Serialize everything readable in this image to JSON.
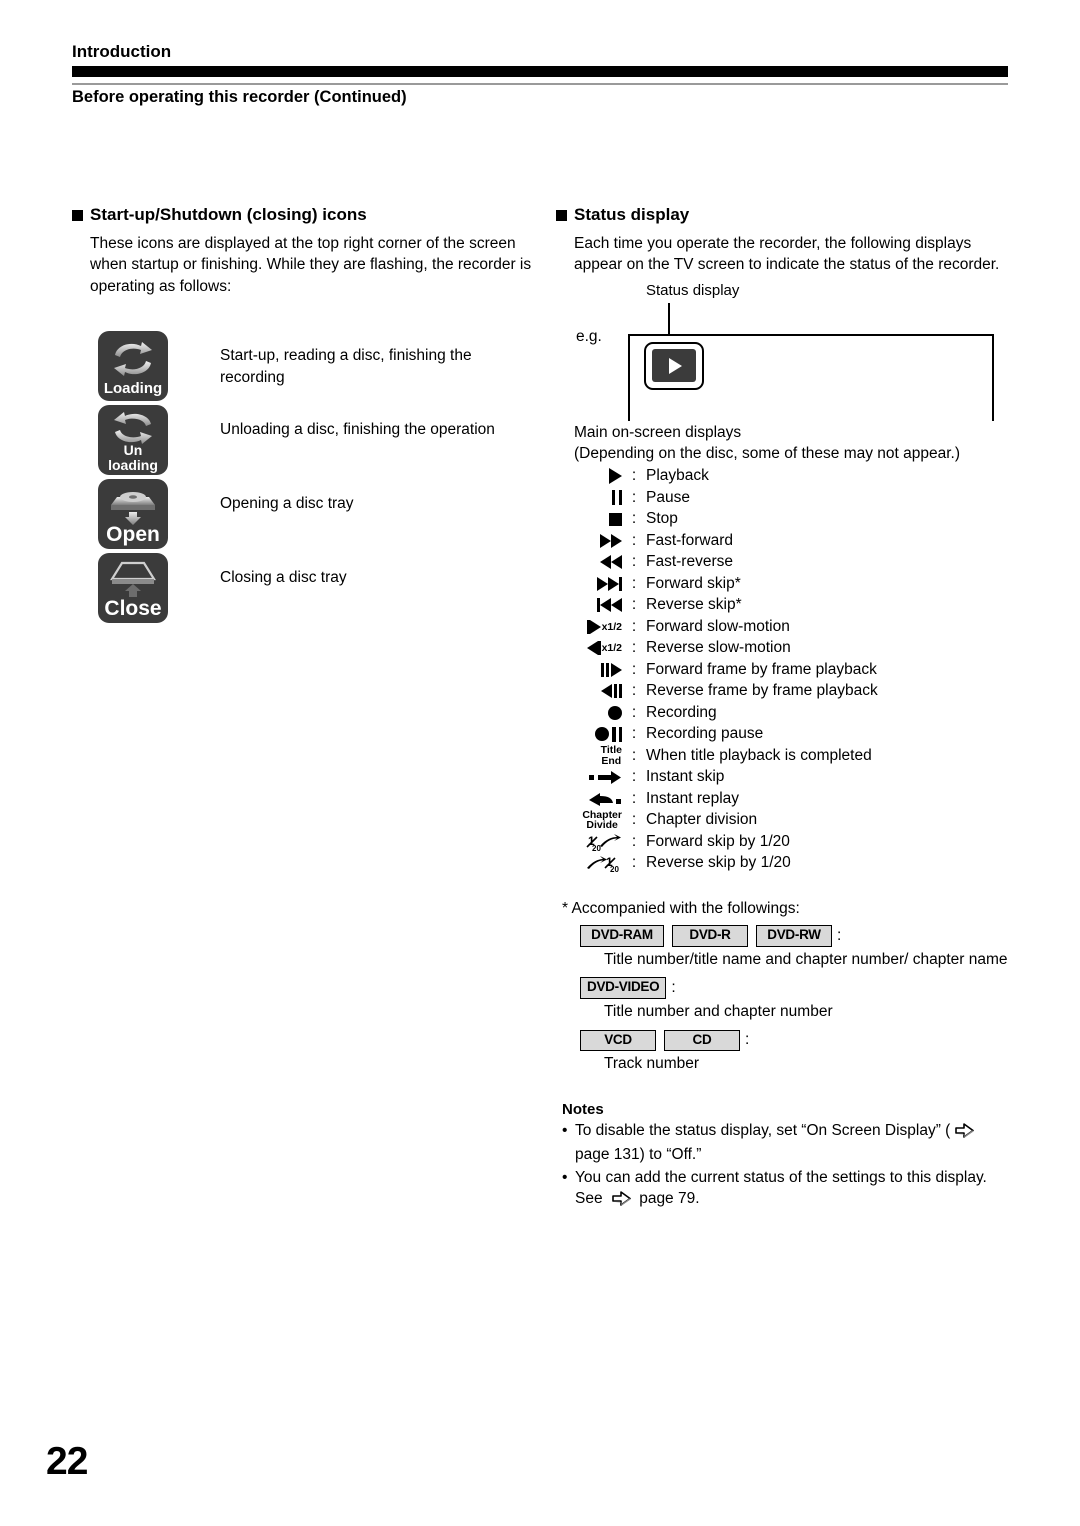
{
  "header": {
    "section": "Introduction",
    "title": "Before operating this recorder (Continued)"
  },
  "page_number": "22",
  "left_column": {
    "heading": "Start-up/Shutdown (closing) icons",
    "intro": "These icons are displayed at the top right corner of the screen when startup or finishing. While they are flashing, the recorder is operating as follows:",
    "icons": [
      {
        "label_line1": "Loading",
        "label_line2": "",
        "icon": "loading-arrows-icon",
        "description": "Start-up, reading a disc, finishing the recording"
      },
      {
        "label_line1": "Un",
        "label_line2": "loading",
        "icon": "unloading-arrows-icon",
        "description": "Unloading a disc, finishing the operation"
      },
      {
        "label_line1": "Open",
        "label_line2": "",
        "icon": "tray-open-icon",
        "description": "Opening a disc tray"
      },
      {
        "label_line1": "Close",
        "label_line2": "",
        "icon": "tray-close-icon",
        "description": "Closing a disc tray"
      }
    ]
  },
  "right_column": {
    "heading": "Status display",
    "intro": "Each time you operate the recorder, the following displays appear on the TV screen to indicate the status of the recorder.",
    "figure": {
      "caption": "Status display",
      "eg_label": "e.g.",
      "chip_icon": "play-icon"
    },
    "list_intro_line1": "Main on-screen displays",
    "list_intro_line2": "(Depending on the disc, some of these may not appear.)",
    "colon": ":",
    "symbols": [
      {
        "icon": "play-icon",
        "label": "Playback"
      },
      {
        "icon": "pause-icon",
        "label": "Pause"
      },
      {
        "icon": "stop-icon",
        "label": "Stop"
      },
      {
        "icon": "fast-forward-icon",
        "label": "Fast-forward"
      },
      {
        "icon": "fast-reverse-icon",
        "label": "Fast-reverse"
      },
      {
        "icon": "forward-skip-icon",
        "label": "Forward skip*"
      },
      {
        "icon": "reverse-skip-icon",
        "label": "Reverse skip*"
      },
      {
        "icon": "forward-slow-motion-icon",
        "label": "Forward slow-motion",
        "sup": "x1/2"
      },
      {
        "icon": "reverse-slow-motion-icon",
        "label": "Reverse slow-motion",
        "sup": "x1/2"
      },
      {
        "icon": "forward-frame-step-icon",
        "label": "Forward frame by frame playback"
      },
      {
        "icon": "reverse-frame-step-icon",
        "label": "Reverse frame by frame playback"
      },
      {
        "icon": "record-icon",
        "label": "Recording"
      },
      {
        "icon": "record-pause-icon",
        "label": "Recording pause"
      },
      {
        "icon": "title-end-icon",
        "label": "When title playback is completed",
        "mini1": "Title",
        "mini2": "End"
      },
      {
        "icon": "instant-skip-icon",
        "label": "Instant skip"
      },
      {
        "icon": "instant-replay-icon",
        "label": "Instant replay"
      },
      {
        "icon": "chapter-divide-icon",
        "label": "Chapter division",
        "mini1": "Chapter",
        "mini2": "Divide"
      },
      {
        "icon": "forward-skip-twentieth-icon",
        "label": "Forward skip by 1/20"
      },
      {
        "icon": "reverse-skip-twentieth-icon",
        "label": "Reverse skip by 1/20"
      }
    ],
    "footnote": "* Accompanied with the followings:",
    "disc_groups": [
      {
        "badges": [
          "DVD-RAM",
          "DVD-R",
          "DVD-RW"
        ],
        "colon": ":",
        "description": "Title number/title name and chapter number/ chapter name"
      },
      {
        "badges": [
          "DVD-VIDEO"
        ],
        "colon": ":",
        "description": "Title number and chapter number"
      },
      {
        "badges": [
          "VCD",
          "CD"
        ],
        "colon": ":",
        "description": "Track  number"
      }
    ],
    "notes": {
      "title": "Notes",
      "items": [
        {
          "bullet": "•",
          "text_before": "To disable the status display, set “On Screen Display” (",
          "arrow": "page-arrow-icon",
          "text_after": " page 131) to “Off.”"
        },
        {
          "bullet": "•",
          "text_before": "You can add the current status of the settings to this display. See ",
          "arrow": "page-arrow-icon",
          "text_after": " page 79."
        }
      ]
    }
  }
}
